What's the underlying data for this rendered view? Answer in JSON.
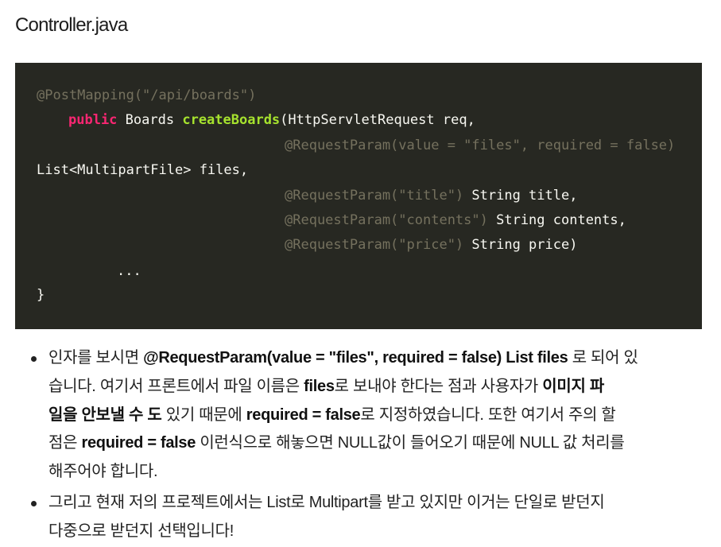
{
  "file": {
    "title": "Controller.java"
  },
  "code": {
    "annotation_mapping": "@PostMapping(\"/api/boards\")",
    "keyword_public": "public",
    "type_boards": "Boards",
    "method_name": "createBoards",
    "sig_rest": "(HttpServletRequest req,",
    "param_files_annotation": "@RequestParam(value = \"files\", required = false)",
    "param_files_decl": "List<MultipartFile> files,",
    "param_title_annotation": "@RequestParam(\"title\")",
    "param_title_decl": " String title,",
    "param_contents_annotation": "@RequestParam(\"contents\")",
    "param_contents_decl": " String contents,",
    "param_price_annotation": "@RequestParam(\"price\")",
    "param_price_decl": " String price)",
    "ellipsis": "...",
    "closing_brace": "}"
  },
  "notes": {
    "item1": {
      "l1_a": "인자를 보시면 ",
      "l1_b": "@RequestParam(value = \"files\", required = false) List files",
      "l1_c": " 로 되어 있",
      "l2_a": "습니다. 여기서 프론트에서 파일 이름은 ",
      "l2_b": "files",
      "l2_c": "로 보내야 한다는 점과 사용자가 ",
      "l2_d": "이미지 파",
      "l3_a": "일을 안보낼 수 도",
      "l3_b": " 있기 때문에 ",
      "l3_c": "required = false",
      "l3_d": "로 지정하였습니다. 또한 여기서 주의 할",
      "l4_a": "점은 ",
      "l4_b": "required = false",
      "l4_c": " 이런식으로 해놓으면 NULL값이 들어오기 때문에 NULL 값 처리를",
      "l5": "해주어야 합니다."
    },
    "item2": {
      "l1": "그리고 현재 저의 프로젝트에서는 List로 Multipart를 받고 있지만 이거는 단일로 받던지",
      "l2": "다중으로 받던지 선택입니다!"
    }
  }
}
